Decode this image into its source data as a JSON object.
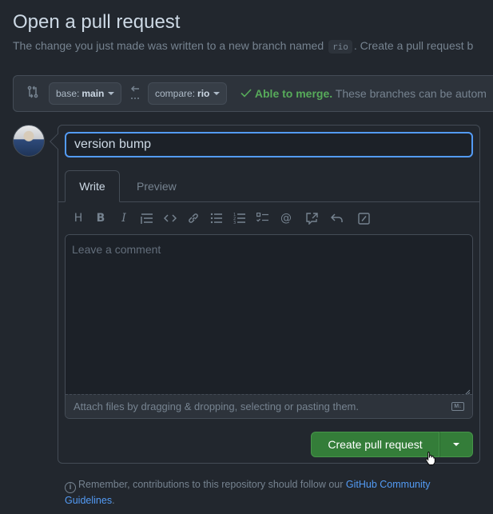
{
  "page": {
    "title": "Open a pull request",
    "subtitle_before": "The change you just made was written to a new branch named",
    "branch_name": "rio",
    "subtitle_after": ". Create a pull request b"
  },
  "compare": {
    "base_label": "base:",
    "base_value": "main",
    "compare_label": "compare:",
    "compare_value": "rio",
    "merge_ok": "Able to merge.",
    "merge_rest": "These branches can be autom"
  },
  "form": {
    "title_value": "version bump",
    "tabs": [
      "Write",
      "Preview"
    ],
    "comment_placeholder": "Leave a comment",
    "attach_text": "Attach files by dragging & dropping, selecting or pasting them.",
    "markdown_badge": "M↓"
  },
  "toolbar": {
    "icons": [
      "heading-icon",
      "bold-icon",
      "italic-icon",
      "quote-icon",
      "code-icon",
      "link-icon",
      "unordered-list-icon",
      "ordered-list-icon",
      "task-list-icon",
      "mention-icon",
      "reference-icon",
      "reply-icon",
      "slash-command-icon"
    ]
  },
  "actions": {
    "create_label": "Create pull request"
  },
  "footer": {
    "note": "Remember, contributions to this repository should follow our",
    "link": "GitHub Community Guidelines",
    "end": "."
  },
  "colors": {
    "background": "#22272e",
    "accent_blue": "#539bf5",
    "success_green": "#57ab5a",
    "button_green": "#347d39"
  }
}
